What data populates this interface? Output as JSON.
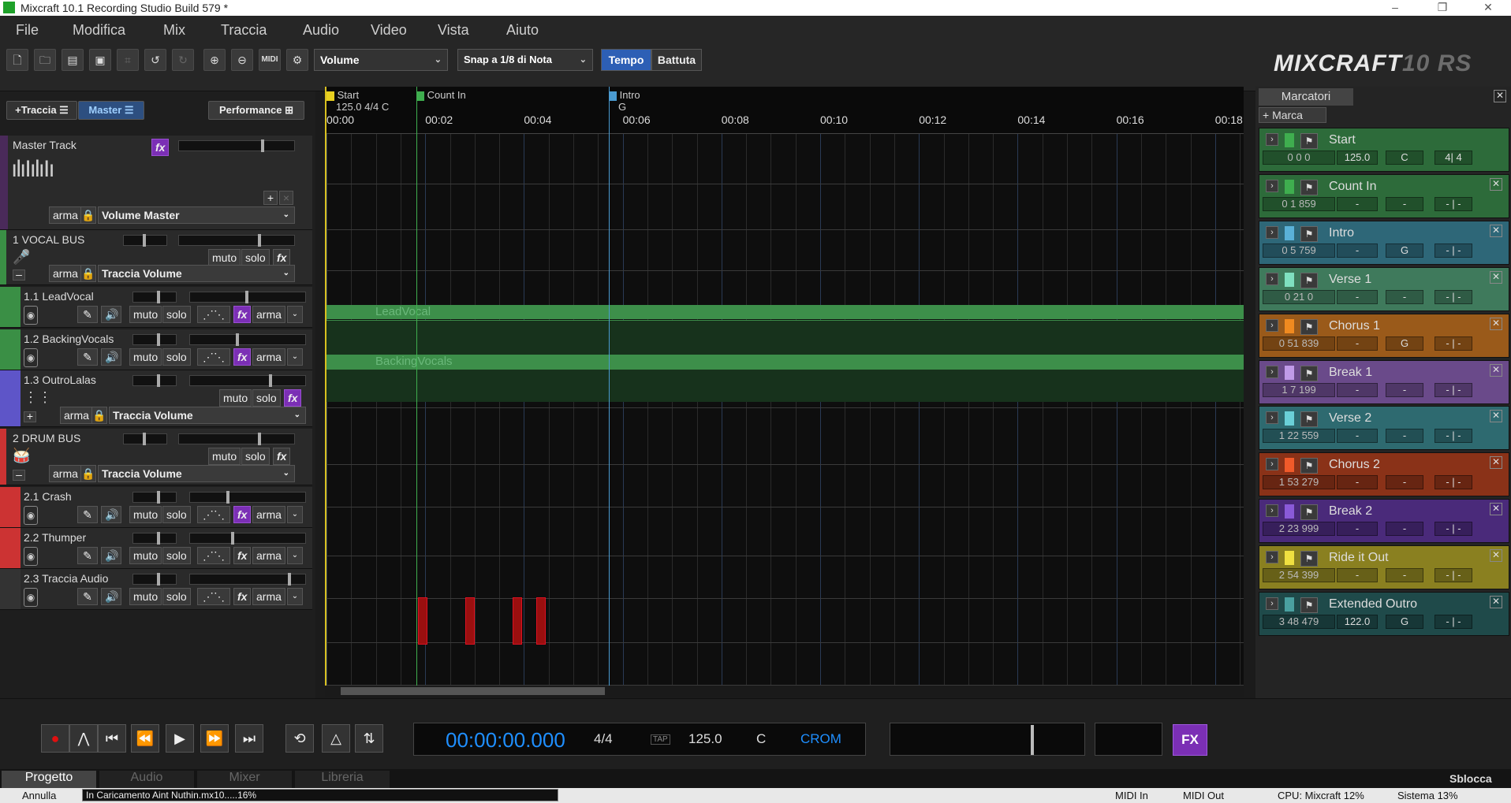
{
  "window": {
    "title": "Mixcraft 10.1 Recording Studio Build 579 *",
    "minimize": "–",
    "maximize": "❐",
    "close": "✕"
  },
  "menu": [
    "File",
    "Modifica",
    "Mix",
    "Traccia",
    "Audio",
    "Video",
    "Vista",
    "Aiuto"
  ],
  "toolbar": {
    "automation_select": "Volume",
    "snap_select": "Snap a 1/8 di Nota",
    "tempo_toggle": "Tempo",
    "battuta_toggle": "Battuta",
    "midi_label": "MIDI"
  },
  "brand": {
    "name": "MIXCRAFT",
    "version": "10",
    "edition": "RS"
  },
  "left": {
    "add_track": "+Traccia",
    "master_tab": "Master",
    "performance": "Performance",
    "master": {
      "name": "Master Track",
      "fx": "fx",
      "arm": "arma",
      "volume": "Volume Master",
      "plus": "+",
      "x": "×"
    },
    "tracks": [
      {
        "name": "1 VOCAL BUS",
        "type": "bus",
        "color": "#3a8f45",
        "mute": "muto",
        "solo": "solo",
        "fx": "fx",
        "arm": "arma",
        "vol": "Traccia Volume"
      },
      {
        "name": "1.1 LeadVocal",
        "type": "audio",
        "color": "#3a8f45",
        "mute": "muto",
        "solo": "solo",
        "fx": "fx",
        "arm": "arma"
      },
      {
        "name": "1.2 BackingVocals",
        "type": "audio",
        "color": "#3a8f45",
        "mute": "muto",
        "solo": "solo",
        "fx": "fx",
        "arm": "arma"
      },
      {
        "name": "1.3 OutroLalas",
        "type": "midi",
        "color": "#5e55c8",
        "mute": "muto",
        "solo": "solo",
        "fx": "fx",
        "arm": "arma",
        "vol": "Traccia Volume"
      },
      {
        "name": "2 DRUM BUS",
        "type": "bus",
        "color": "#c33",
        "mute": "muto",
        "solo": "solo",
        "fx": "fx",
        "arm": "arma",
        "vol": "Traccia Volume"
      },
      {
        "name": "2.1 Crash",
        "type": "audio",
        "color": "#c33",
        "mute": "muto",
        "solo": "solo",
        "fx": "fx",
        "arm": "arma"
      },
      {
        "name": "2.2 Thumper",
        "type": "audio",
        "color": "#c33",
        "mute": "muto",
        "solo": "solo",
        "fx": "fx",
        "arm": "arma"
      },
      {
        "name": "2.3 Traccia Audio",
        "type": "audio",
        "color": "#333",
        "mute": "muto",
        "solo": "solo",
        "fx": "fx",
        "arm": "arma"
      }
    ]
  },
  "timeline": {
    "ticks": [
      "00:00",
      "00:02",
      "00:04",
      "00:06",
      "00:08",
      "00:10",
      "00:12",
      "00:14",
      "00:16",
      "00:18"
    ],
    "flags": [
      {
        "label": "Start",
        "sub": "125.0 4/4 C",
        "color": "#e8d020"
      },
      {
        "label": "Count In",
        "sub": "",
        "color": "#3fae4f"
      },
      {
        "label": "Intro",
        "sub": "G",
        "color": "#4a9ad0"
      }
    ],
    "clips": [
      "LeadVocal",
      "BackingVocals"
    ]
  },
  "markers": {
    "title": "Marcatori",
    "add": "+ Marca",
    "close": "✕",
    "items": [
      {
        "name": "Start",
        "pos": "0 0 0",
        "tempo": "125.0",
        "key": "C",
        "sig": "4| 4",
        "color": "#2d6b3a",
        "sw": "#3fae4f"
      },
      {
        "name": "Count In",
        "pos": "0 1 859",
        "tempo": "-",
        "key": "-",
        "sig": "- | -",
        "color": "#2d6b3a",
        "sw": "#3fae4f"
      },
      {
        "name": "Intro",
        "pos": "0 5 759",
        "tempo": "-",
        "key": "G",
        "sig": "- | -",
        "color": "#2e6778",
        "sw": "#5ab1d8"
      },
      {
        "name": "Verse 1",
        "pos": "0 21 0",
        "tempo": "-",
        "key": "-",
        "sig": "- | -",
        "color": "#3f7a5c",
        "sw": "#7fe0c0"
      },
      {
        "name": "Chorus 1",
        "pos": "0 51 839",
        "tempo": "-",
        "key": "G",
        "sig": "- | -",
        "color": "#9a5a1a",
        "sw": "#f08a20"
      },
      {
        "name": "Break 1",
        "pos": "1 7 199",
        "tempo": "-",
        "key": "-",
        "sig": "- | -",
        "color": "#6a4a8a",
        "sw": "#c09ae8"
      },
      {
        "name": "Verse 2",
        "pos": "1 22 559",
        "tempo": "-",
        "key": "-",
        "sig": "- | -",
        "color": "#2e6a70",
        "sw": "#6ad0d8"
      },
      {
        "name": "Chorus 2",
        "pos": "1 53 279",
        "tempo": "-",
        "key": "-",
        "sig": "- | -",
        "color": "#8a3218",
        "sw": "#f05a2a"
      },
      {
        "name": "Break 2",
        "pos": "2 23 999",
        "tempo": "-",
        "key": "-",
        "sig": "- | -",
        "color": "#4a2a7a",
        "sw": "#8a5ad8"
      },
      {
        "name": "Ride it Out",
        "pos": "2 54 399",
        "tempo": "-",
        "key": "-",
        "sig": "- | -",
        "color": "#8a8020",
        "sw": "#f0e040"
      },
      {
        "name": "Extended Outro",
        "pos": "3 48 479",
        "tempo": "122.0",
        "key": "G",
        "sig": "- | -",
        "color": "#1f4a4a",
        "sw": "#4aa0a0"
      }
    ]
  },
  "transport": {
    "time": "00:00:00.000",
    "sig": "4/4",
    "tap": "TAP",
    "tempo": "125.0",
    "key": "C",
    "crom": "CROM",
    "fx": "FX"
  },
  "tabs": [
    "Progetto",
    "Audio",
    "Mixer",
    "Libreria"
  ],
  "unlock": "Sblocca",
  "status": {
    "cancel": "Annulla",
    "loading": "In Caricamento Aint Nuthin.mx10.....16%",
    "midi_in": "MIDI In",
    "midi_out": "MIDI Out",
    "cpu": "CPU: Mixcraft 12%",
    "system": "Sistema 13%"
  }
}
